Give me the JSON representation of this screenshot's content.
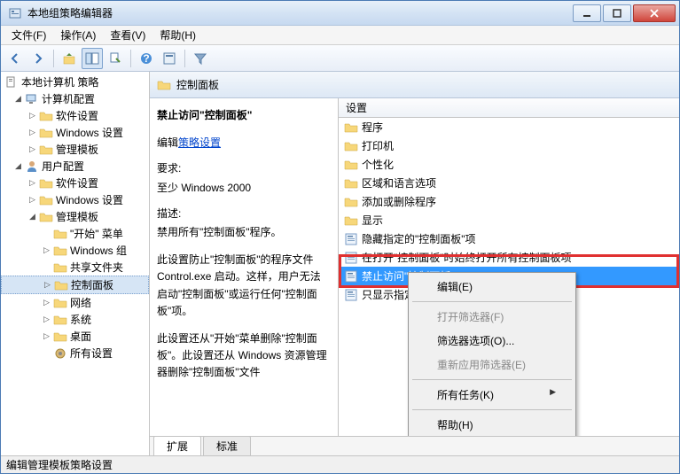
{
  "window": {
    "title": "本地组策略编辑器"
  },
  "menubar": {
    "file": "文件(F)",
    "action": "操作(A)",
    "view": "查看(V)",
    "help": "帮助(H)"
  },
  "tree": {
    "root": "本地计算机 策略",
    "computer_cfg": "计算机配置",
    "software1": "软件设置",
    "windows1": "Windows 设置",
    "admin1": "管理模板",
    "user_cfg": "用户配置",
    "software2": "软件设置",
    "windows2": "Windows 设置",
    "admin2": "管理模板",
    "start_menu": "\"开始\" 菜单",
    "windows_comp": "Windows 组",
    "shared_folders": "共享文件夹",
    "control_panel": "控制面板",
    "network": "网络",
    "system": "系统",
    "desktop": "桌面",
    "all_settings": "所有设置"
  },
  "content": {
    "header_title": "控制面板",
    "setting_title": "禁止访问\"控制面板\"",
    "edit_label": "编辑",
    "edit_link": "策略设置",
    "req_label": "要求:",
    "req_text": "至少 Windows 2000",
    "desc_label": "描述:",
    "desc_p1": "禁用所有\"控制面板\"程序。",
    "desc_p2": "此设置防止\"控制面板\"的程序文件 Control.exe 启动。这样，用户无法启动\"控制面板\"或运行任何\"控制面板\"项。",
    "desc_p3": "此设置还从\"开始\"菜单删除\"控制面板\"。此设置还从 Windows 资源管理器删除\"控制面板\"文件"
  },
  "list": {
    "header": "设置",
    "items": [
      "程序",
      "打印机",
      "个性化",
      "区域和语言选项",
      "添加或删除程序",
      "显示",
      "隐藏指定的\"控制面板\"项",
      "在打开\"控制面板\"时始终打开所有控制面板项",
      "禁止访问\"控制面板\"",
      "只显示指定的\"控制面板\"项"
    ]
  },
  "context_menu": {
    "edit": "编辑(E)",
    "open_filter": "打开筛选器(F)",
    "filter_options": "筛选器选项(O)...",
    "reapply_filter": "重新应用筛选器(E)",
    "all_tasks": "所有任务(K)",
    "help": "帮助(H)"
  },
  "tabs": {
    "extended": "扩展",
    "standard": "标准"
  },
  "statusbar": {
    "text": "编辑管理模板策略设置"
  }
}
